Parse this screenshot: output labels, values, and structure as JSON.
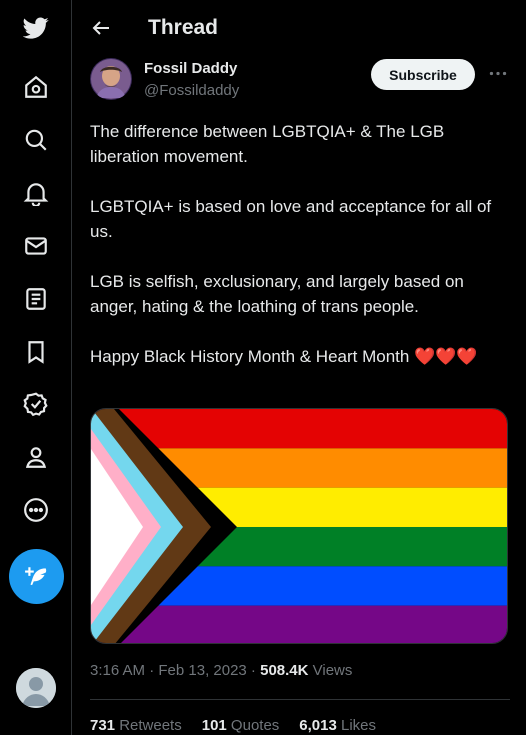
{
  "nav": {
    "items": [
      {
        "icon": "twitter-bird-icon"
      },
      {
        "icon": "home-icon"
      },
      {
        "icon": "search-icon"
      },
      {
        "icon": "bell-icon"
      },
      {
        "icon": "mail-icon"
      },
      {
        "icon": "list-icon"
      },
      {
        "icon": "bookmark-icon"
      },
      {
        "icon": "verified-icon"
      },
      {
        "icon": "profile-icon"
      },
      {
        "icon": "more-circle-icon"
      }
    ],
    "compose_icon": "compose-icon",
    "accent": "#1d9bf0"
  },
  "header": {
    "title": "Thread"
  },
  "tweet": {
    "author_name": "Fossil Daddy",
    "handle": "@Fossildaddy",
    "subscribe_label": "Subscribe",
    "paragraphs": [
      "The difference between LGBTQIA+ & The LGB liberation movement.",
      "LGBTQIA+ is based on love and acceptance for all of us.",
      "LGB is selfish, exclusionary, and largely based on anger, hating & the loathing of trans people.",
      "Happy Black History Month & Heart Month"
    ],
    "hearts": "❤️❤️❤️",
    "time": "3:16 AM · Feb 13, 2023 · ",
    "views_count": "508.4K",
    "views_label": " Views",
    "retweets_count": "731",
    "retweets_label": " Retweets",
    "quotes_count": "101",
    "quotes_label": " Quotes",
    "likes_count": "6,013",
    "likes_label": " Likes"
  },
  "colors": {
    "background": "#000000",
    "text": "#e7e9ea",
    "muted": "#71767b",
    "heart": "#f91880"
  }
}
